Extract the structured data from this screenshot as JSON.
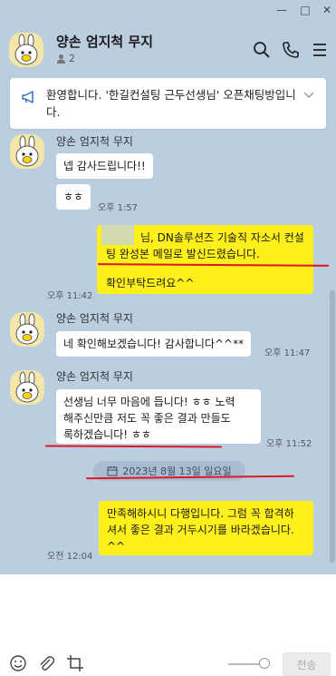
{
  "window": {
    "minimize": "—",
    "maximize": "□",
    "close": "✕"
  },
  "header": {
    "title": "양손 엄지척 무지",
    "member_count": "2",
    "icons": [
      "search-icon",
      "call-icon",
      "menu-icon"
    ]
  },
  "notice": {
    "text": "환영합니다. '한길컨설팅 근두선생님' 오픈채팅방입니다."
  },
  "messages": [
    {
      "sender": "양손 엄지척 무지",
      "bubbles": [
        "넵 감사드립니다!!",
        "ㅎㅎ"
      ],
      "time": "오후 1:57"
    },
    {
      "mine": true,
      "lines": [
        "님, DN솔루션즈 기술직 자소서 컨설",
        "팅 완성본 메일로 발신드렸습니다.",
        "",
        "확인부탁드려요^^"
      ],
      "time": "오후 11:42"
    },
    {
      "sender": "양손 엄지척 무지",
      "bubbles": [
        "네 확인해보겠습니다! 감사합니다^^**"
      ],
      "time": "오후 11:47"
    },
    {
      "sender": "양손 엄지척 무지",
      "lines": [
        "선생님 너무 마음에 듭니다! ㅎㅎ 노력",
        "해주신만큼 저도 꼭 좋은 결과 만들도",
        "록하겠습니다! ㅎㅎ"
      ],
      "time": "오후 11:52"
    },
    {
      "date": "2023년 8월 13일 일요일"
    },
    {
      "mine": true,
      "lines": [
        "만족해하시니 다행입니다. 그럼 꼭 합격하",
        "셔서 좋은 결과 거두시기를 바라겠습니다.",
        "^^"
      ],
      "time": "오전 12:04"
    }
  ],
  "input": {
    "tools": [
      "emoji-icon",
      "attach-icon",
      "crop-icon"
    ],
    "send_label": "전송"
  },
  "colors": {
    "chat_bg": "#bacee0",
    "my_bubble": "#fef01b",
    "annotation": "#e0152a"
  }
}
